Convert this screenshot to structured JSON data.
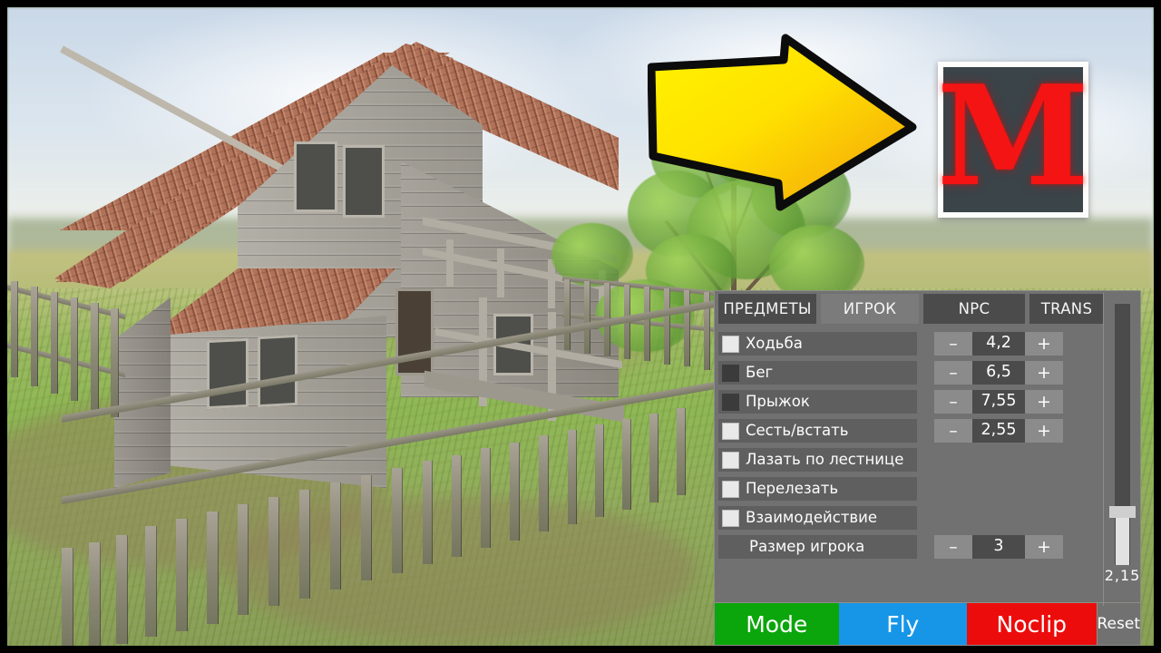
{
  "overlay": {
    "arrow": {
      "name": "right-arrow-annotation",
      "fill_start": "#ffe800",
      "fill_end": "#f5a310",
      "stroke": "#0a0a0a"
    },
    "logo": {
      "letter": "M",
      "color": "#f41414",
      "background": "#3b4449",
      "border": "#fdfdfb"
    }
  },
  "panel": {
    "tabs": [
      {
        "label": "ПРЕДМЕТЫ",
        "active": false
      },
      {
        "label": "ИГРОК",
        "active": true
      },
      {
        "label": "NPC",
        "active": false
      },
      {
        "label": "TRANS",
        "active": false
      }
    ],
    "rows": [
      {
        "label": "Ходьба",
        "checkbox": "on",
        "value": "4,2",
        "minus": "–",
        "plus": "+",
        "has_stepper": true
      },
      {
        "label": "Бег",
        "checkbox": "off",
        "value": "6,5",
        "minus": "–",
        "plus": "+",
        "has_stepper": true
      },
      {
        "label": "Прыжок",
        "checkbox": "off",
        "value": "7,55",
        "minus": "–",
        "plus": "+",
        "has_stepper": true
      },
      {
        "label": "Сесть/встать",
        "checkbox": "on",
        "value": "2,55",
        "minus": "–",
        "plus": "+",
        "has_stepper": true
      },
      {
        "label": "Лазать по лестнице",
        "checkbox": "on",
        "value": "",
        "minus": "–",
        "plus": "+",
        "has_stepper": false
      },
      {
        "label": "Перелезать",
        "checkbox": "on",
        "value": "",
        "minus": "–",
        "plus": "+",
        "has_stepper": false
      },
      {
        "label": "Взаимодействие",
        "checkbox": "on",
        "value": "",
        "minus": "–",
        "plus": "+",
        "has_stepper": false
      },
      {
        "label": "Размер игрока",
        "checkbox": "none",
        "value": "3",
        "minus": "–",
        "plus": "+",
        "has_stepper": true
      }
    ],
    "slider": {
      "value": "2,15"
    },
    "actions": {
      "mode": "Mode",
      "fly": "Fly",
      "noclip": "Noclip",
      "reset": "Reset"
    },
    "colors": {
      "panel_bg": "#717171",
      "row_bg": "#5f5f5f",
      "value_bg": "#4b4b4b",
      "step_bg": "#8b8b8b",
      "tab_active": "#7b7b7b",
      "tab_inactive": "#4b4b4b",
      "mode": "#0ba60b",
      "fly": "#1796e8",
      "noclip": "#ed0c0c"
    }
  }
}
